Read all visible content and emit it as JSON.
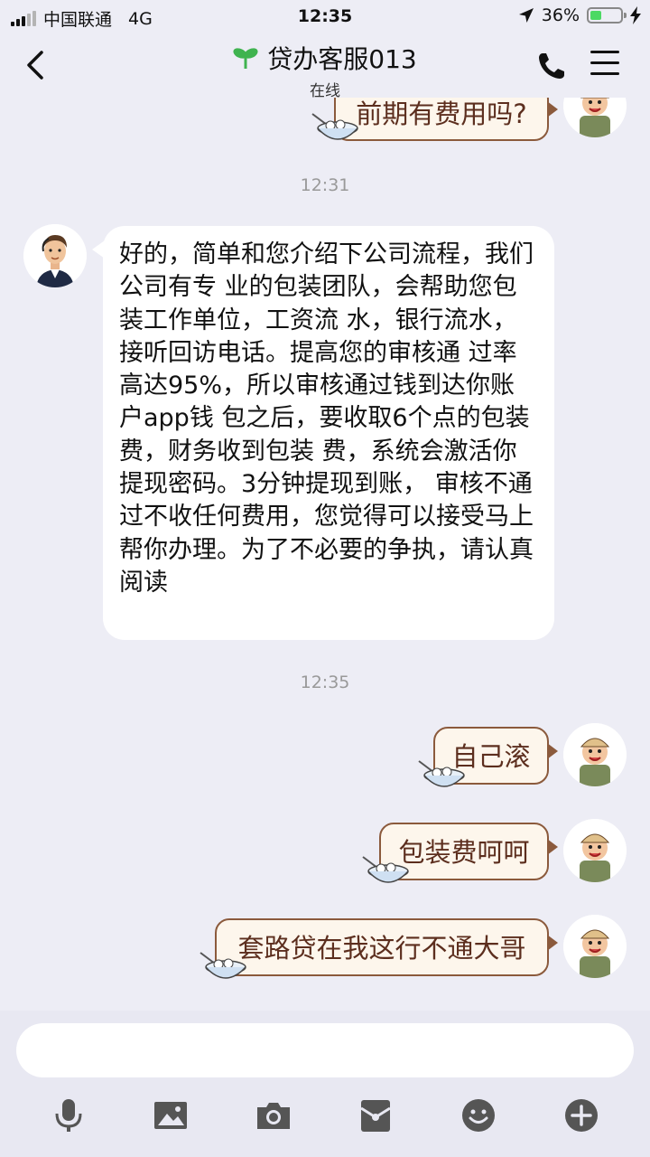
{
  "status_bar": {
    "carrier": "中国联通",
    "network": "4G",
    "time": "12:35",
    "battery": "36%"
  },
  "header": {
    "title": "贷办客服013",
    "status": "在线"
  },
  "chat": {
    "prev_message": "前期有费用吗?",
    "timestamp_1": "12:31",
    "agent_message": "好的，简单和您介绍下公司流程，我们公司有专 业的包装团队，会帮助您包装工作单位，工资流 水，银行流水，接听回访电话。提高您的审核通 过率高达95%，所以审核通过钱到达你账户app钱 包之后，要收取6个点的包装费，财务收到包装 费，系统会激活你提现密码。3分钟提现到账， 审核不通过不收任何费用，您觉得可以接受马上 帮你办理。为了不必要的争执，请认真阅读",
    "timestamp_2": "12:35",
    "user_messages": [
      "自己滚",
      "包装费呵呵",
      "套路贷在我这行不通大哥"
    ]
  },
  "input": {
    "placeholder": ""
  },
  "toolbar": [
    "microphone-icon",
    "image-icon",
    "camera-icon",
    "red-packet-icon",
    "emoji-icon",
    "plus-icon"
  ],
  "colors": {
    "background": "#ededf5",
    "bubble_user": "#fdf6ec",
    "bubble_user_border": "#8b5a3c",
    "bubble_user_text": "#5c2e1e",
    "battery": "#4cd964",
    "title_leaf": "#3fb34f"
  }
}
